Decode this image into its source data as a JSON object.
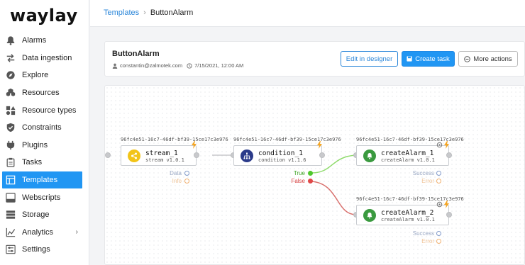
{
  "app": {
    "logo": "waylay"
  },
  "sidebar": {
    "items": [
      {
        "label": "Alarms",
        "icon": "bell-icon"
      },
      {
        "label": "Data ingestion",
        "icon": "arrows-exchange-icon"
      },
      {
        "label": "Explore",
        "icon": "compass-icon"
      },
      {
        "label": "Resources",
        "icon": "cubes-icon"
      },
      {
        "label": "Resource types",
        "icon": "shapes-icon"
      },
      {
        "label": "Constraints",
        "icon": "shield-check-icon"
      },
      {
        "label": "Plugins",
        "icon": "plug-icon"
      },
      {
        "label": "Tasks",
        "icon": "clipboard-icon"
      },
      {
        "label": "Templates",
        "icon": "template-icon",
        "active": true
      },
      {
        "label": "Webscripts",
        "icon": "http-icon"
      },
      {
        "label": "Storage",
        "icon": "database-icon"
      },
      {
        "label": "Analytics",
        "icon": "chart-icon",
        "has_submenu": true
      },
      {
        "label": "Settings",
        "icon": "sliders-icon"
      }
    ]
  },
  "breadcrumb": {
    "parent": "Templates",
    "separator": "›",
    "current": "ButtonAlarm"
  },
  "task": {
    "title": "ButtonAlarm",
    "user": "constantin@zalmotek.com",
    "date": "7/15/2021, 12:00 AM",
    "buttons": {
      "edit": "Edit in designer",
      "create": "Create task",
      "more": "More actions"
    }
  },
  "colors": {
    "accent": "#2196f3",
    "link": "#2a86d9",
    "true_wire": "#8fdb6c",
    "false_wire": "#d9726f",
    "true_dot": "#4fc72d",
    "false_dot": "#e04848",
    "bolt": "#f5a623"
  },
  "flow": {
    "nodes": [
      {
        "id": "96fc4e51-16c7-46df-bf39-15ce17c3e976",
        "name": "stream_1",
        "version": "stream v1.0.1",
        "badge_color": "#f2c418",
        "icon": "share-icon",
        "outputs": [
          "Data",
          "Info"
        ]
      },
      {
        "id": "96fc4e51-16c7-46df-bf39-15ce17c3e976",
        "name": "condition_1",
        "version": "condition v1.1.6",
        "badge_color": "#2b3b8a",
        "icon": "sitemap-icon",
        "outputs": [
          "True",
          "False"
        ]
      },
      {
        "id": "96fc4e51-16c7-46df-bf39-15ce17c3e976",
        "name": "createAlarm_1",
        "version": "createAlarm v1.0.1",
        "badge_color": "#3a9a3f",
        "icon": "bell-icon",
        "outputs": [
          "Success",
          "Error"
        ]
      },
      {
        "id": "96fc4e51-16c7-46df-bf39-15ce17c3e976",
        "name": "createAlarm_2",
        "version": "createAlarm v1.0.1",
        "badge_color": "#3a9a3f",
        "icon": "bell-icon",
        "outputs": [
          "Success",
          "Error"
        ]
      }
    ]
  }
}
